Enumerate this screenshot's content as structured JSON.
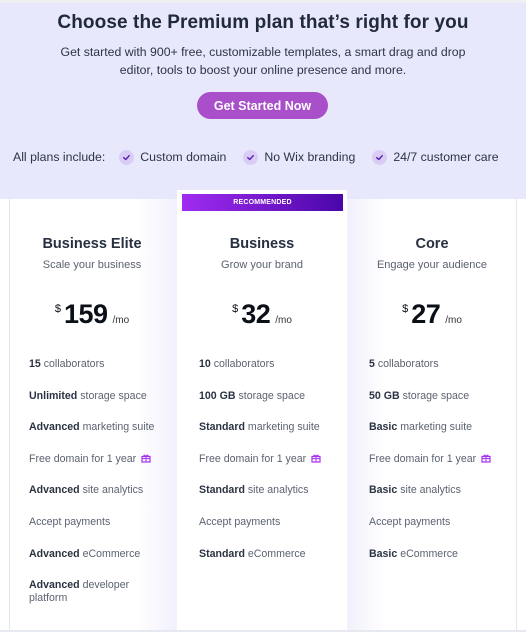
{
  "hero": {
    "title": "Choose the Premium plan that’s right for you",
    "subtitle": "Get started with 900+ free, customizable templates, a smart drag and drop editor, tools to boost your online presence and more.",
    "cta_label": "Get Started Now",
    "includes_label": "All plans include:",
    "includes": [
      {
        "icon": "check-icon",
        "label": "Custom domain"
      },
      {
        "icon": "check-icon",
        "label": "No Wix branding"
      },
      {
        "icon": "check-icon",
        "label": "24/7 customer care"
      }
    ]
  },
  "colors": {
    "hero_bg": "#e7e8fb",
    "cta_bg": "#a84fc9",
    "badge_start": "#a12cf2",
    "badge_end": "#4a06a8",
    "gift_icon": "#a92ff0"
  },
  "plans": [
    {
      "name": "Business Elite",
      "tagline": "Scale your business",
      "currency": "$",
      "price": "159",
      "period": "/mo",
      "recommended": false,
      "features": [
        {
          "bold": "15",
          "text": " collaborators"
        },
        {
          "bold": "Unlimited",
          "text": " storage space"
        },
        {
          "bold": "Advanced",
          "text": " marketing suite"
        },
        {
          "bold": "",
          "text": "Free domain for 1 year",
          "icon": "gift-icon"
        },
        {
          "bold": "Advanced",
          "text": " site analytics"
        },
        {
          "bold": "",
          "text": "Accept payments"
        },
        {
          "bold": "Advanced",
          "text": " eCommerce"
        },
        {
          "bold": "Advanced",
          "text": " developer platform"
        }
      ]
    },
    {
      "name": "Business",
      "tagline": "Grow your brand",
      "currency": "$",
      "price": "32",
      "period": "/mo",
      "recommended": true,
      "badge": "RECOMMENDED",
      "features": [
        {
          "bold": "10",
          "text": " collaborators"
        },
        {
          "bold": "100 GB",
          "text": " storage space"
        },
        {
          "bold": "Standard",
          "text": " marketing suite"
        },
        {
          "bold": "",
          "text": "Free domain for 1 year",
          "icon": "gift-icon"
        },
        {
          "bold": "Standard",
          "text": " site analytics"
        },
        {
          "bold": "",
          "text": "Accept payments"
        },
        {
          "bold": "Standard",
          "text": " eCommerce"
        }
      ]
    },
    {
      "name": "Core",
      "tagline": "Engage your audience",
      "currency": "$",
      "price": "27",
      "period": "/mo",
      "recommended": false,
      "features": [
        {
          "bold": "5",
          "text": " collaborators"
        },
        {
          "bold": "50 GB",
          "text": " storage space"
        },
        {
          "bold": "Basic",
          "text": " marketing suite"
        },
        {
          "bold": "",
          "text": "Free domain for 1 year",
          "icon": "gift-icon"
        },
        {
          "bold": "Basic",
          "text": " site analytics"
        },
        {
          "bold": "",
          "text": "Accept payments"
        },
        {
          "bold": "Basic",
          "text": " eCommerce"
        }
      ]
    }
  ]
}
